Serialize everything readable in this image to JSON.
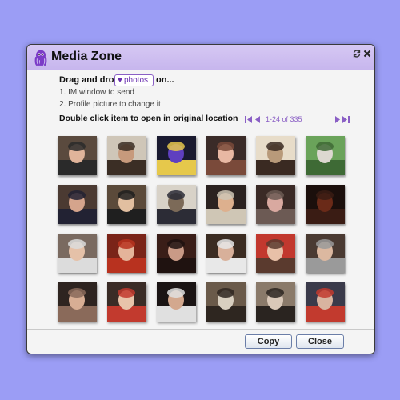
{
  "window": {
    "title": "Media Zone",
    "refresh_icon": "refresh-icon",
    "close_icon": "close-icon"
  },
  "instructions": {
    "drag_label": "Drag and drop",
    "media_type": "photos",
    "on_label": "on...",
    "step1": "1. IM window to send",
    "step2": "2. Profile picture to change it",
    "double_click": "Double click item to open in original location"
  },
  "pager": {
    "range": "1-24 of 335",
    "accent_color": "#8a5fc5"
  },
  "thumbnails": [
    {
      "icon": "photo-thumbnail",
      "colors": [
        "#5a4a3e",
        "#e0b49a",
        "#2a2a2a"
      ]
    },
    {
      "icon": "photo-thumbnail",
      "colors": [
        "#cfc6b8",
        "#c79a7c",
        "#3b2e25"
      ]
    },
    {
      "icon": "photo-thumbnail",
      "colors": [
        "#1a1a30",
        "#5f3fbf",
        "#e6c84b"
      ]
    },
    {
      "icon": "photo-thumbnail",
      "colors": [
        "#3a2b28",
        "#e8b8a3",
        "#7a4a3a"
      ]
    },
    {
      "icon": "photo-thumbnail",
      "colors": [
        "#e7dcc9",
        "#b89a7a",
        "#3a2a22"
      ]
    },
    {
      "icon": "photo-thumbnail",
      "colors": [
        "#6aa35a",
        "#dcd8d0",
        "#3e6a35"
      ]
    },
    {
      "icon": "photo-thumbnail",
      "colors": [
        "#4b3a32",
        "#d5a48c",
        "#222233"
      ]
    },
    {
      "icon": "photo-thumbnail",
      "colors": [
        "#5b4a3a",
        "#e2bfa0",
        "#1f1f1f"
      ]
    },
    {
      "icon": "photo-thumbnail",
      "colors": [
        "#d8d2c8",
        "#7c6a58",
        "#2c2c36"
      ]
    },
    {
      "icon": "photo-thumbnail",
      "colors": [
        "#2b2220",
        "#ddb08e",
        "#cfc6b5"
      ]
    },
    {
      "icon": "photo-thumbnail",
      "colors": [
        "#3a2a26",
        "#d9a9a0",
        "#6c5a54"
      ]
    },
    {
      "icon": "photo-thumbnail",
      "colors": [
        "#1b0f0c",
        "#6a2a18",
        "#3a1c14"
      ]
    },
    {
      "icon": "photo-thumbnail",
      "colors": [
        "#7a6a60",
        "#e5c1a8",
        "#dcdcdc"
      ]
    },
    {
      "icon": "photo-thumbnail",
      "colors": [
        "#7a2418",
        "#e4b49a",
        "#b8321f"
      ]
    },
    {
      "icon": "photo-thumbnail",
      "colors": [
        "#3a1e18",
        "#c99a86",
        "#1f1210"
      ]
    },
    {
      "icon": "photo-thumbnail",
      "colors": [
        "#3b2c22",
        "#d8b09a",
        "#e8e8e8"
      ]
    },
    {
      "icon": "photo-thumbnail",
      "colors": [
        "#c2382e",
        "#e8c0a8",
        "#5a3a2e"
      ]
    },
    {
      "icon": "photo-thumbnail",
      "colors": [
        "#4a3a32",
        "#dcb8a0",
        "#9a9a9a"
      ]
    },
    {
      "icon": "photo-thumbnail",
      "colors": [
        "#2e2420",
        "#d8ae94",
        "#8a6a5a"
      ]
    },
    {
      "icon": "photo-thumbnail",
      "colors": [
        "#3a2c26",
        "#e8c4aa",
        "#c23a2e"
      ]
    },
    {
      "icon": "photo-thumbnail",
      "colors": [
        "#1a1414",
        "#d3a88e",
        "#e0e0e0"
      ]
    },
    {
      "icon": "photo-thumbnail",
      "colors": [
        "#6a5a4a",
        "#d8cfc0",
        "#2e2620"
      ]
    },
    {
      "icon": "photo-thumbnail",
      "colors": [
        "#8a7a6a",
        "#d9c8b8",
        "#2a2420"
      ]
    },
    {
      "icon": "photo-thumbnail",
      "colors": [
        "#3a3a4a",
        "#d8b4a0",
        "#c23a2e"
      ]
    }
  ],
  "buttons": {
    "copy": "Copy",
    "close": "Close"
  }
}
